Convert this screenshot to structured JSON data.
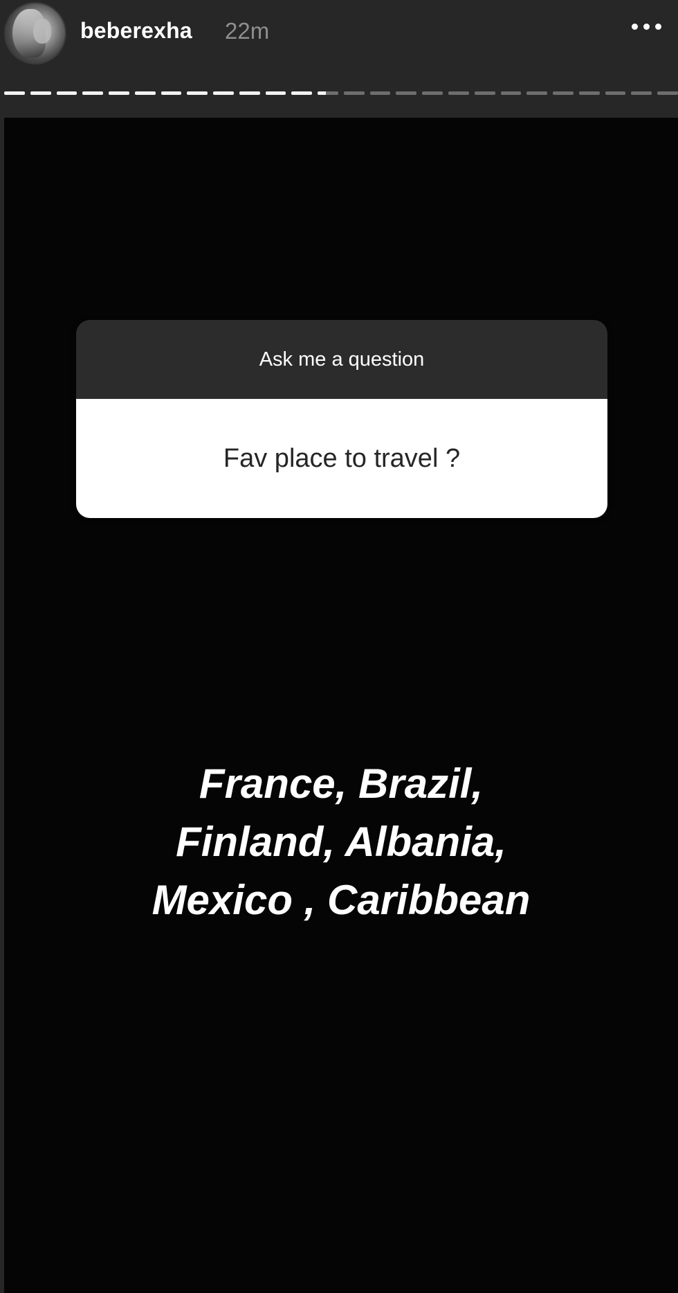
{
  "header": {
    "username": "beberexha",
    "time": "22m"
  },
  "progress": {
    "completed_segments": 12,
    "current_segment_progress": 0.4,
    "total_segments": 26
  },
  "question_sticker": {
    "prompt": "Ask me a question",
    "question": "Fav place to travel ?"
  },
  "answer": {
    "lines": [
      "France, Brazil,",
      "Finland, Albania,",
      "Mexico , Caribbean"
    ]
  }
}
